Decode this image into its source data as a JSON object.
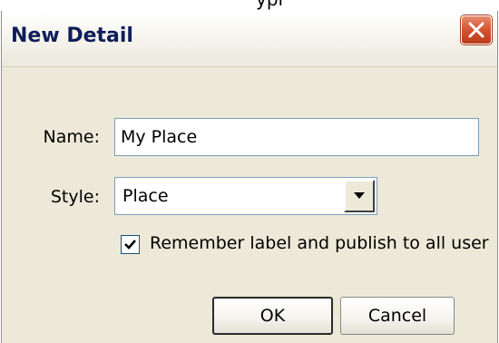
{
  "background_clipped_text": "ypi",
  "dialog": {
    "title": "New Detail",
    "close_icon": "close-icon",
    "name": {
      "label": "Name:",
      "value": "My Place"
    },
    "style": {
      "label": "Style:",
      "selected": "Place",
      "dropdown_icon": "chevron-down-icon"
    },
    "remember": {
      "checked": true,
      "label": "Remember label and publish to all user"
    },
    "buttons": {
      "ok": "OK",
      "cancel": "Cancel"
    }
  },
  "colors": {
    "title_text": "#0f1e5a",
    "close_button": "#d25431",
    "dialog_bg": "#ece9d8",
    "input_border": "#7f9db9"
  }
}
